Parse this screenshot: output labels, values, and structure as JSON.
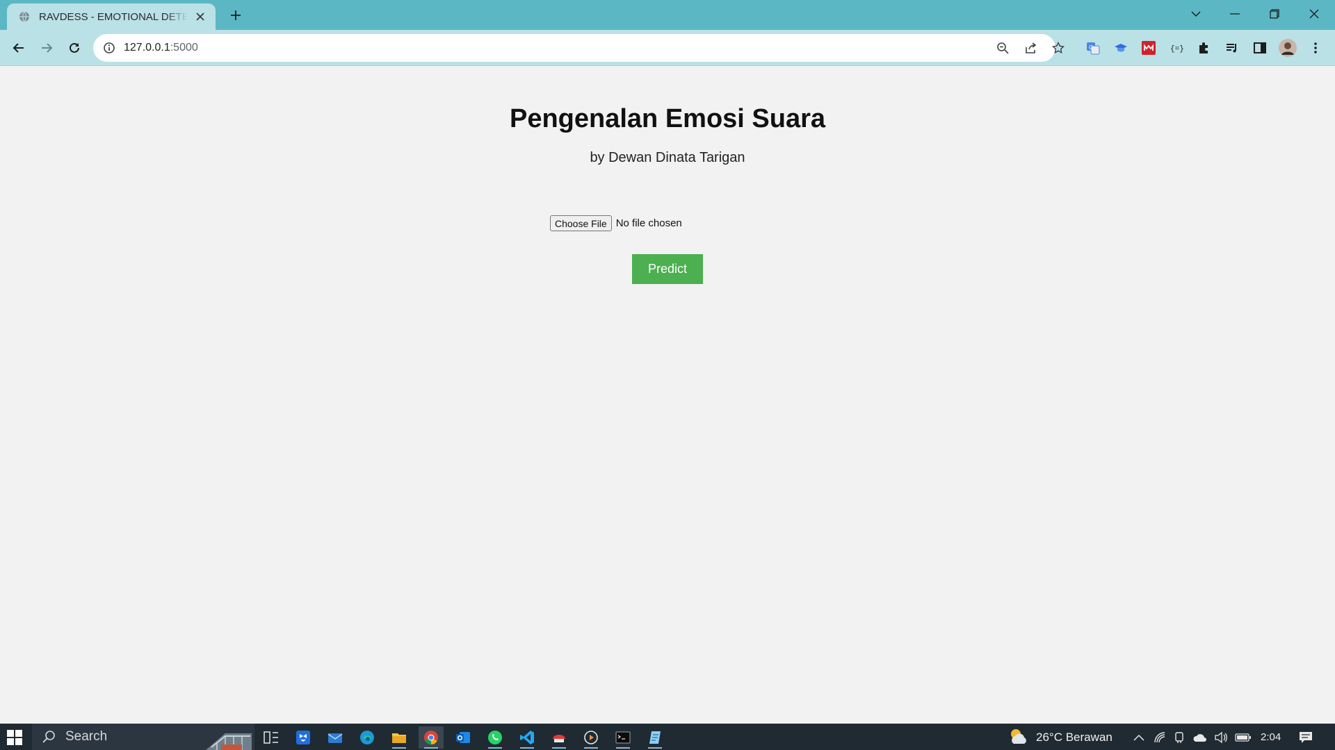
{
  "browser": {
    "tab_title": "RAVDESS - EMOTIONAL DETECTION",
    "url_host": "127.0.0.1",
    "url_port": ":5000"
  },
  "page": {
    "title": "Pengenalan Emosi Suara",
    "subtitle": "by Dewan Dinata Tarigan",
    "file_button": "Choose File",
    "file_status": "No file chosen",
    "predict_button": "Predict"
  },
  "taskbar": {
    "search_label": "Search",
    "weather": "26°C  Berawan",
    "time": "2:04"
  },
  "colors": {
    "titlebar": "#5bb7c3",
    "toolbar": "#b9e1e6",
    "page_bg": "#f2f2f2",
    "predict": "#4caf50",
    "taskbar": "#1f2a33"
  }
}
